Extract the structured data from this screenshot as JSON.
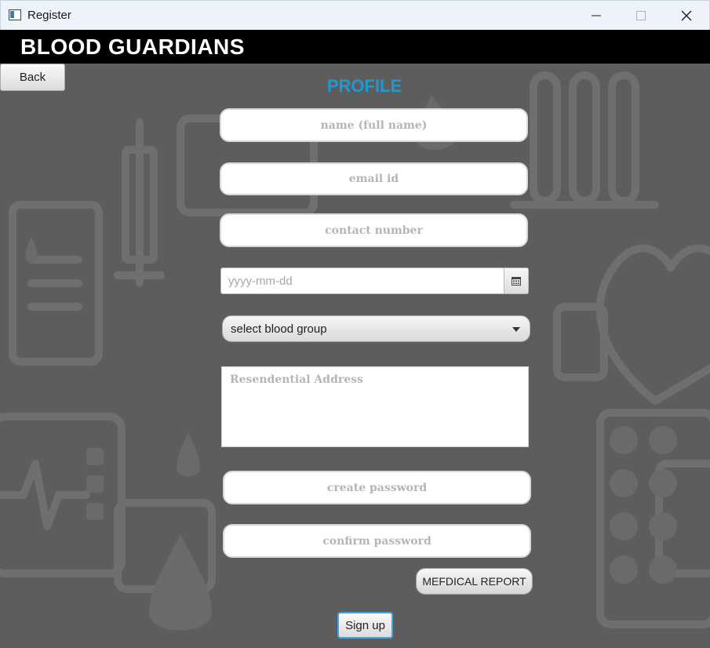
{
  "window": {
    "title": "Register",
    "icons": {
      "app": "window-app-icon",
      "minimize": "minimize-icon",
      "maximize": "maximize-icon",
      "close": "close-icon"
    }
  },
  "header": {
    "brand": "BLOOD GUARDIANS"
  },
  "nav": {
    "back_label": "Back"
  },
  "form": {
    "title": "PROFILE",
    "name_placeholder": "name (full name)",
    "email_placeholder": "email id",
    "contact_placeholder": "contact number",
    "dob_placeholder": "yyyy-mm-dd",
    "blood_group_value": "select blood group",
    "address_placeholder": "Resendential Address",
    "create_password_placeholder": "create password",
    "confirm_password_placeholder": "confirm password",
    "medical_report_label": "MEFDICAL REPORT",
    "signup_label": "Sign up"
  },
  "colors": {
    "title_accent": "#1d9bd1",
    "header_bg": "#000000",
    "content_bg": "#5d5d5d",
    "focus_border": "#43a5e0"
  }
}
